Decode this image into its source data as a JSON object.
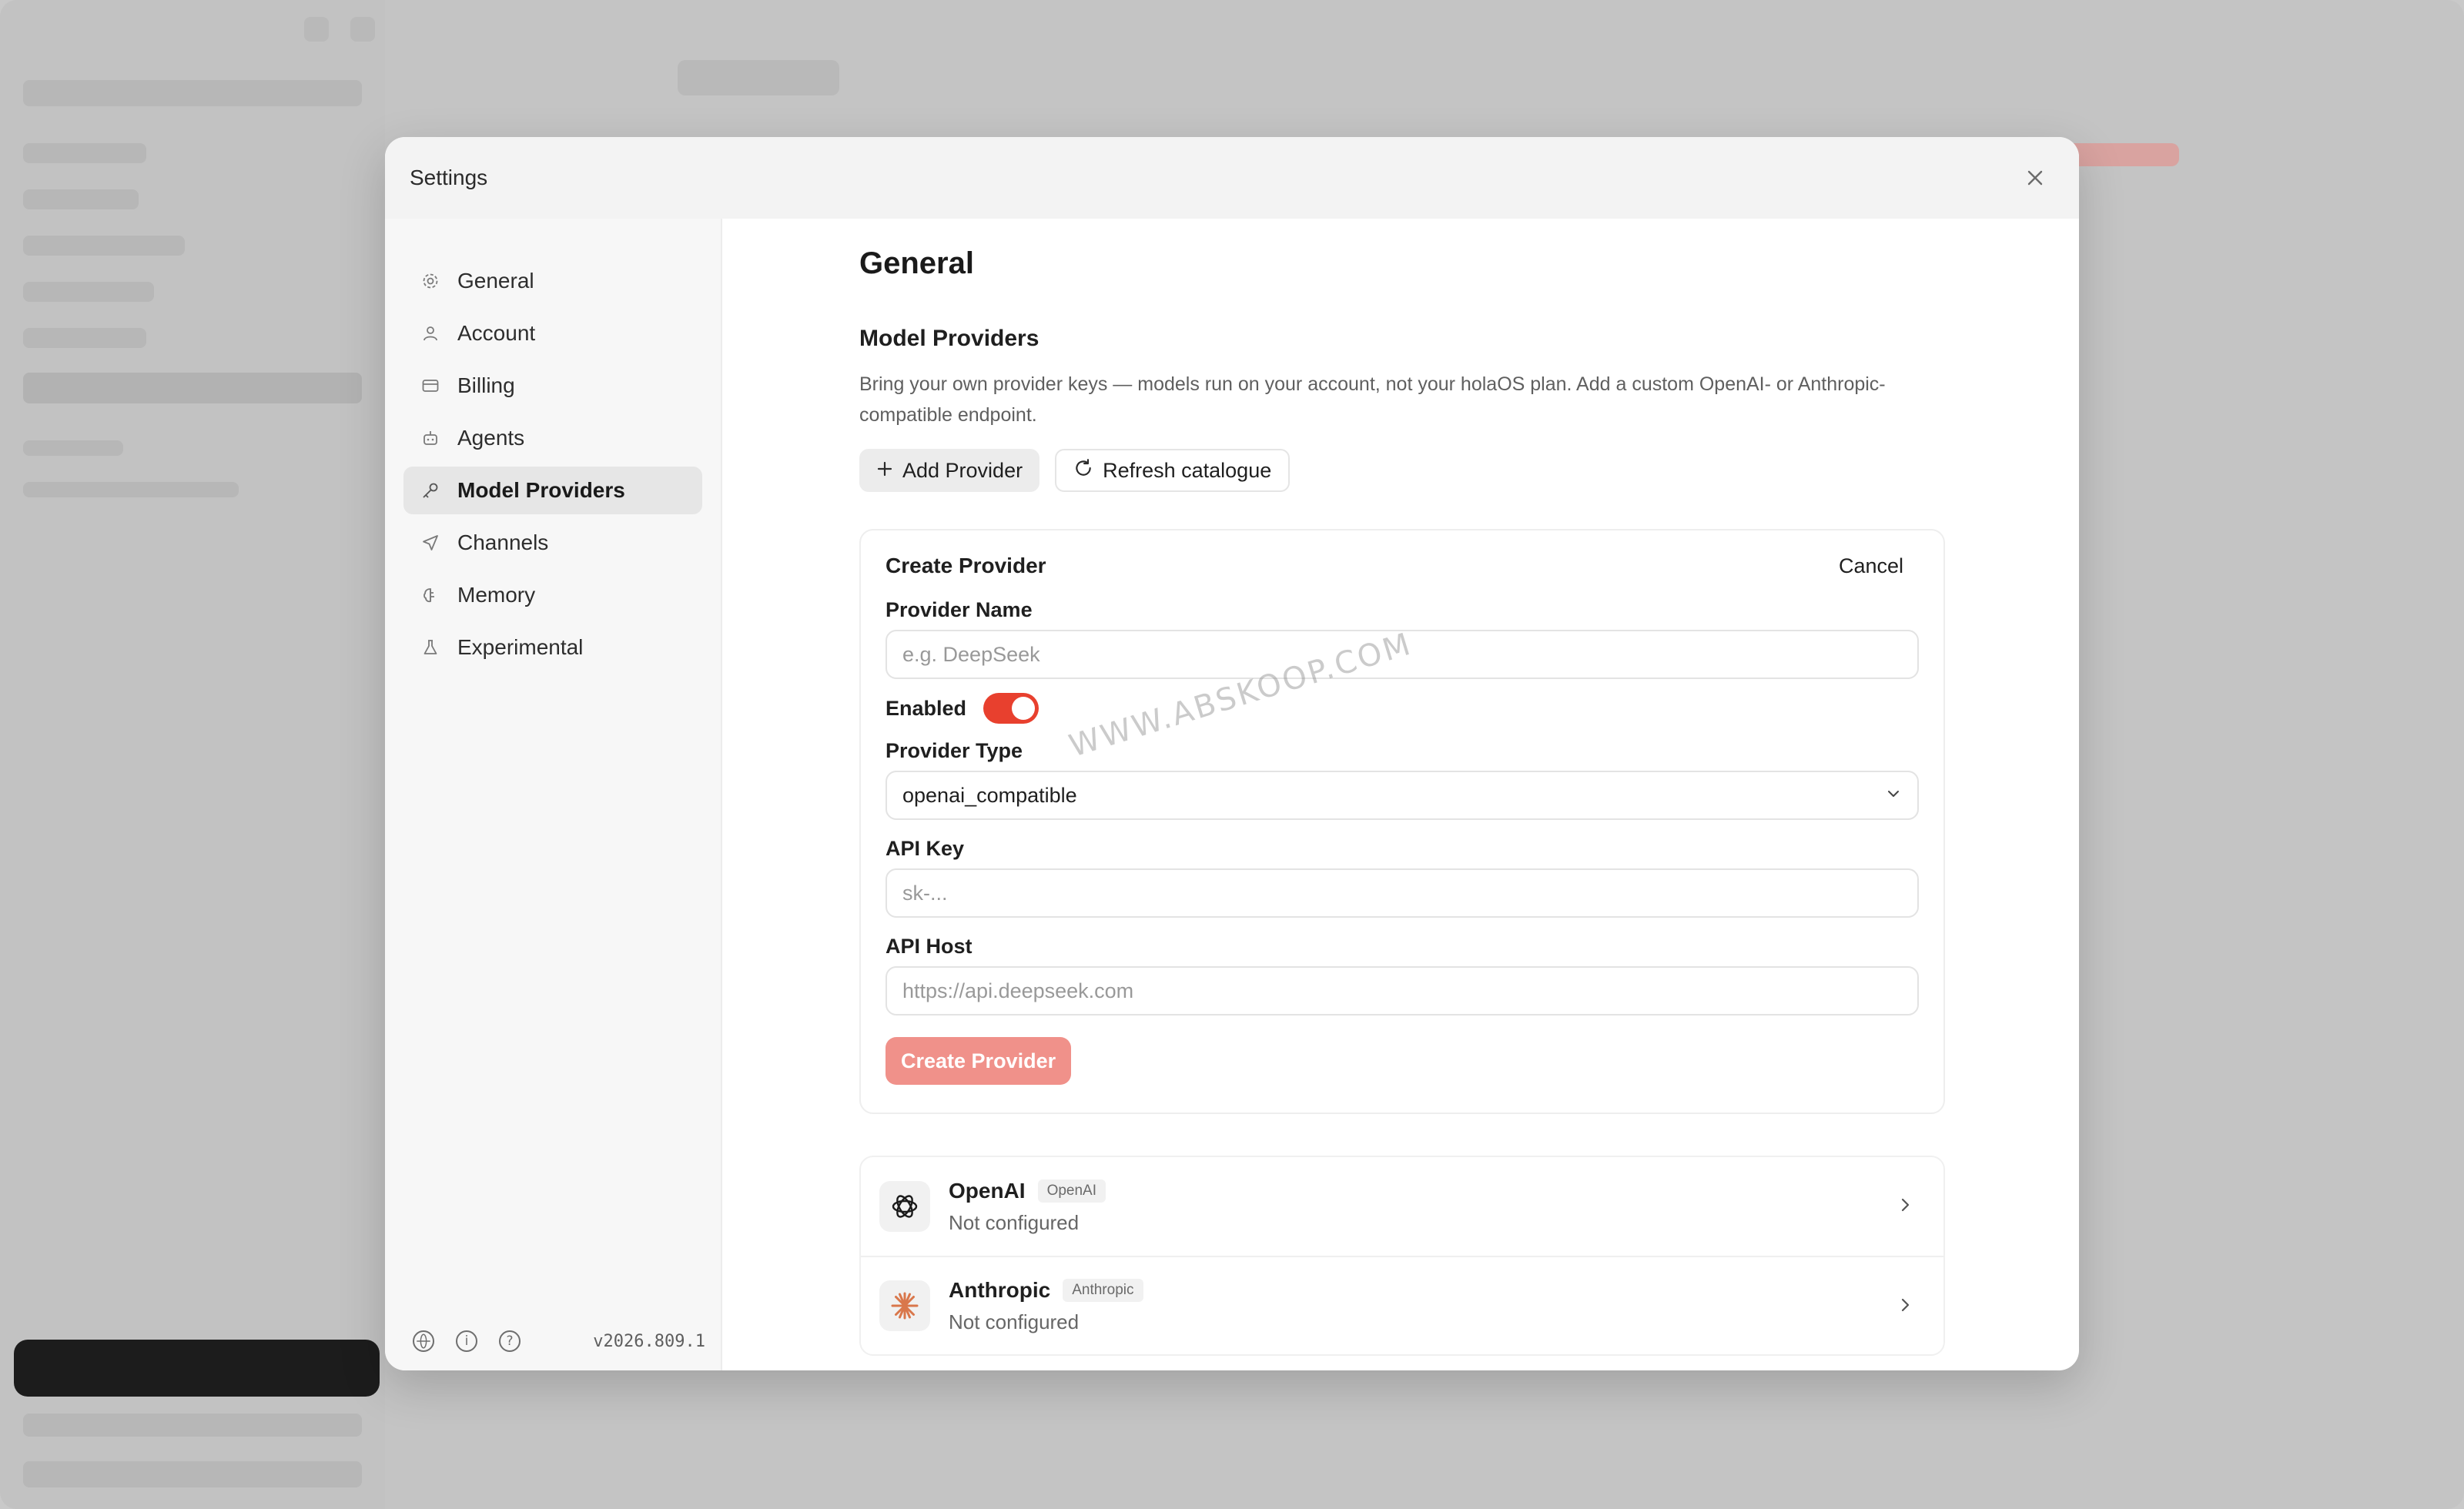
{
  "modal": {
    "title": "Settings",
    "close_icon": "close-icon"
  },
  "nav": {
    "items": [
      {
        "label": "General",
        "icon": "gear-icon"
      },
      {
        "label": "Account",
        "icon": "user-icon"
      },
      {
        "label": "Billing",
        "icon": "credit-card-icon"
      },
      {
        "label": "Agents",
        "icon": "robot-icon"
      },
      {
        "label": "Model Providers",
        "icon": "key-icon",
        "active": true
      },
      {
        "label": "Channels",
        "icon": "send-icon"
      },
      {
        "label": "Memory",
        "icon": "brain-icon"
      },
      {
        "label": "Experimental",
        "icon": "flask-icon"
      }
    ],
    "version": "v2026.809.1"
  },
  "content": {
    "page_title": "General",
    "section_title": "Model Providers",
    "section_desc": "Bring your own provider keys — models run on your account, not your holaOS plan. Add a custom OpenAI- or Anthropic-compatible endpoint.",
    "add_provider_label": "Add Provider",
    "refresh_label": "Refresh catalogue"
  },
  "create_card": {
    "title": "Create Provider",
    "cancel_label": "Cancel",
    "provider_name_label": "Provider Name",
    "provider_name_placeholder": "e.g. DeepSeek",
    "enabled_label": "Enabled",
    "enabled": true,
    "provider_type_label": "Provider Type",
    "provider_type_value": "openai_compatible",
    "api_key_label": "API Key",
    "api_key_placeholder": "sk-...",
    "api_host_label": "API Host",
    "api_host_placeholder": "https://api.deepseek.com",
    "submit_label": "Create Provider"
  },
  "providers": [
    {
      "name": "OpenAI",
      "tag": "OpenAI",
      "status": "Not configured",
      "icon": "openai-logo-icon"
    },
    {
      "name": "Anthropic",
      "tag": "Anthropic",
      "status": "Not configured",
      "icon": "anthropic-logo-icon"
    }
  ],
  "watermark": "WWW.ABSKOOP.COM",
  "colors": {
    "accent": "#e8402e",
    "accent_disabled": "#f0918a"
  }
}
